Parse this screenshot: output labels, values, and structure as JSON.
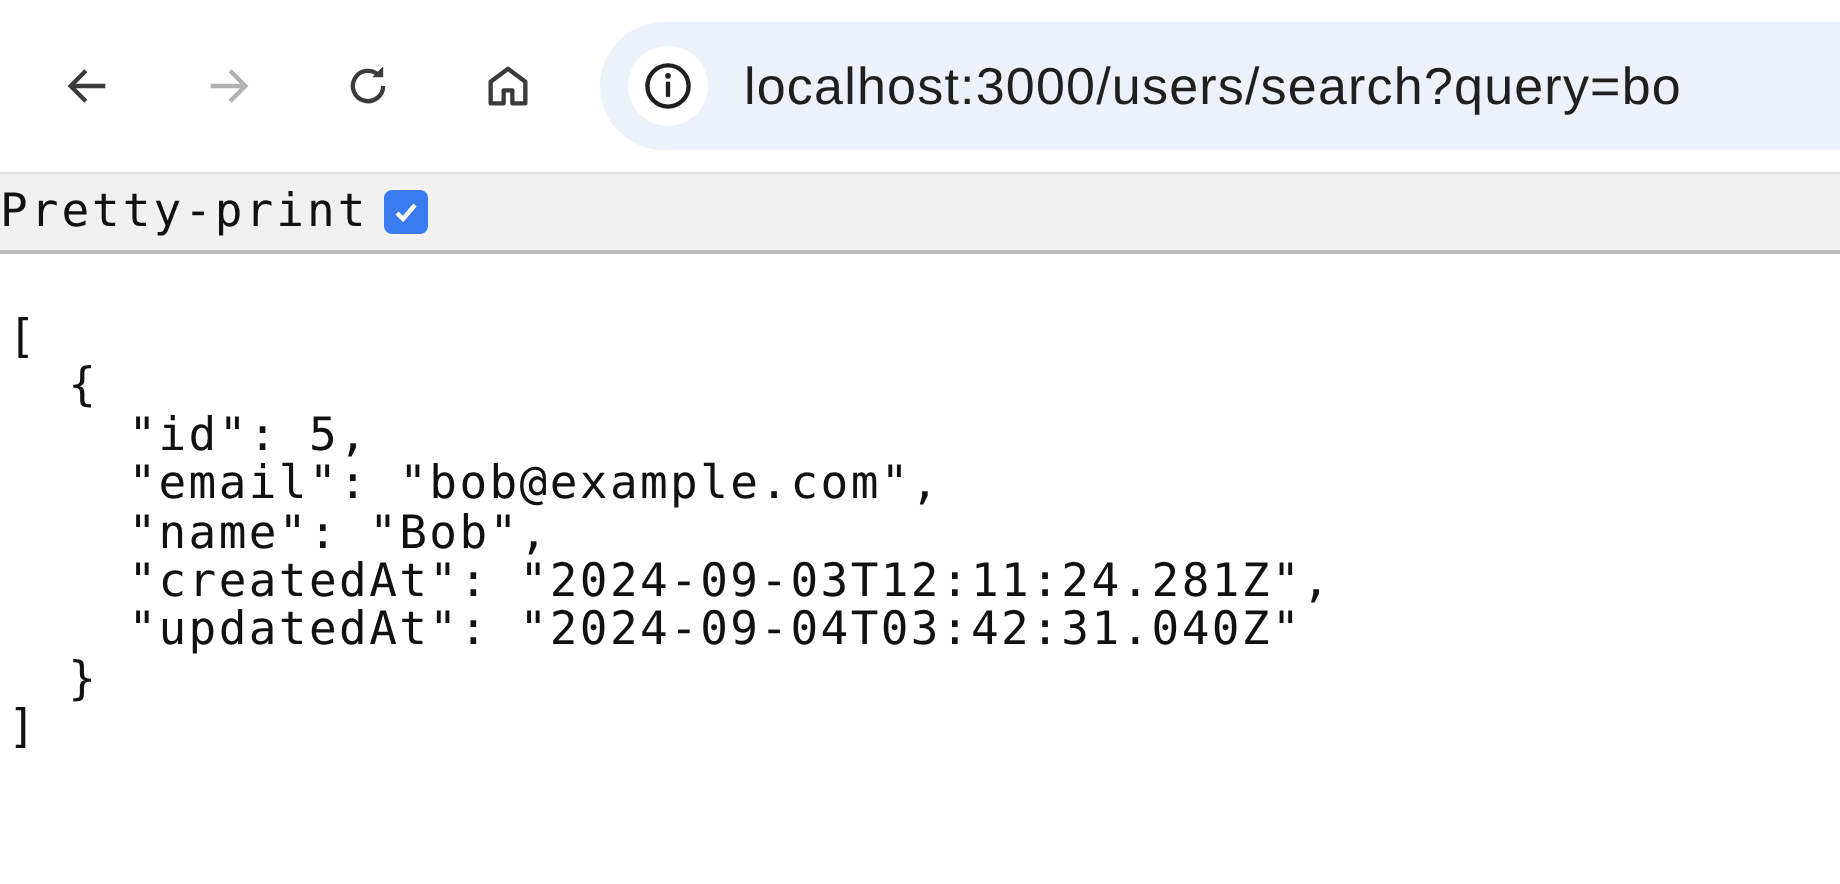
{
  "toolbar": {
    "back": {
      "disabled": false
    },
    "forward": {
      "disabled": true
    },
    "address": "localhost:3000/users/search?query=bo"
  },
  "pretty_print": {
    "label": "Pretty-print",
    "checked": true
  },
  "json_lines": [
    "[",
    "  {",
    "    \"id\": 5,",
    "    \"email\": \"bob@example.com\",",
    "    \"name\": \"Bob\",",
    "    \"createdAt\": \"2024-09-03T12:11:24.281Z\",",
    "    \"updatedAt\": \"2024-09-04T03:42:31.040Z\"",
    "  }",
    "]"
  ]
}
